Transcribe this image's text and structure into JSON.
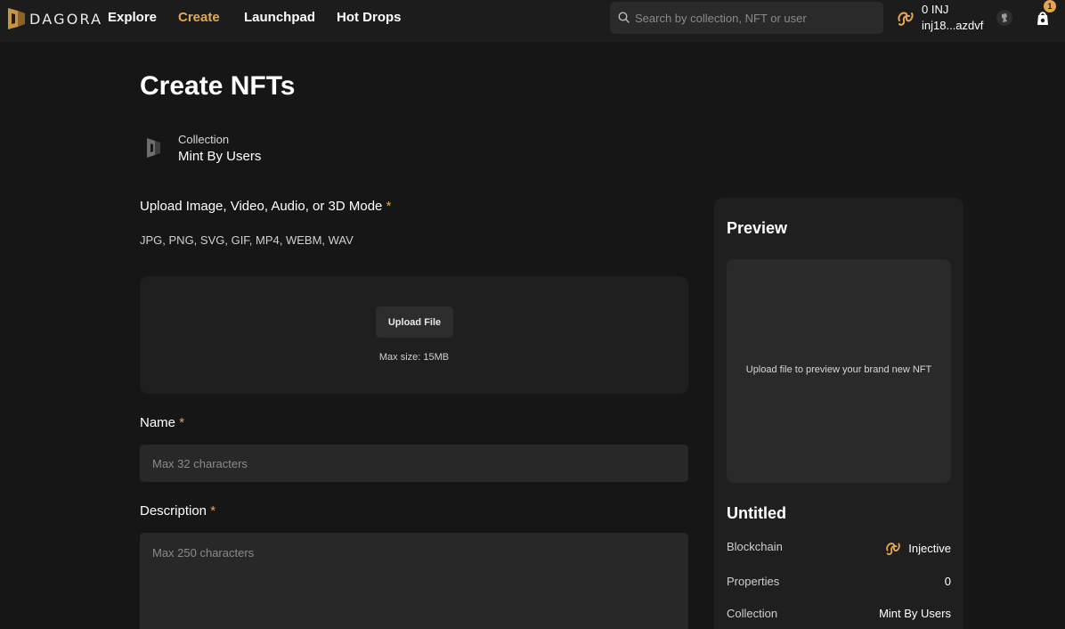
{
  "brand": {
    "name": "DAGORA"
  },
  "nav": {
    "items": [
      {
        "label": "Explore",
        "active": false
      },
      {
        "label": "Create",
        "active": true
      },
      {
        "label": "Launchpad",
        "active": false
      },
      {
        "label": "Hot Drops",
        "active": false
      }
    ]
  },
  "search": {
    "placeholder": "Search by collection, NFT or user",
    "value": ""
  },
  "wallet": {
    "balance": "0 INJ",
    "address": "inj18...azdvf"
  },
  "cart": {
    "count": "1"
  },
  "page": {
    "title": "Create NFTs"
  },
  "collection": {
    "label": "Collection",
    "name": "Mint By Users"
  },
  "upload": {
    "label": "Upload Image, Video, Audio, or 3D Mode",
    "required_mark": "*",
    "formats": "JPG, PNG, SVG, GIF, MP4, WEBM, WAV",
    "button_label": "Upload File",
    "max_size": "Max size: 15MB"
  },
  "name_field": {
    "label": "Name",
    "required_mark": "*",
    "placeholder": "Max 32 characters",
    "value": ""
  },
  "description_field": {
    "label": "Description",
    "required_mark": "*",
    "placeholder": "Max 250 characters",
    "value": ""
  },
  "preview": {
    "title": "Preview",
    "hint": "Upload file to preview your brand new NFT",
    "nft_title": "Untitled",
    "rows": {
      "blockchain": {
        "label": "Blockchain",
        "value": "Injective"
      },
      "properties": {
        "label": "Properties",
        "value": "0"
      },
      "collection": {
        "label": "Collection",
        "value": "Mint By Users"
      }
    }
  },
  "colors": {
    "accent": "#e4a853",
    "background": "#161616",
    "surface": "#1f1f1f",
    "input": "#282828"
  },
  "icons": {
    "logo": "dagora-logo-icon",
    "search": "search-icon",
    "wallet": "injective-icon",
    "avatar": "avatar-icon",
    "cart": "cart-icon",
    "collection": "collection-logo-icon"
  }
}
